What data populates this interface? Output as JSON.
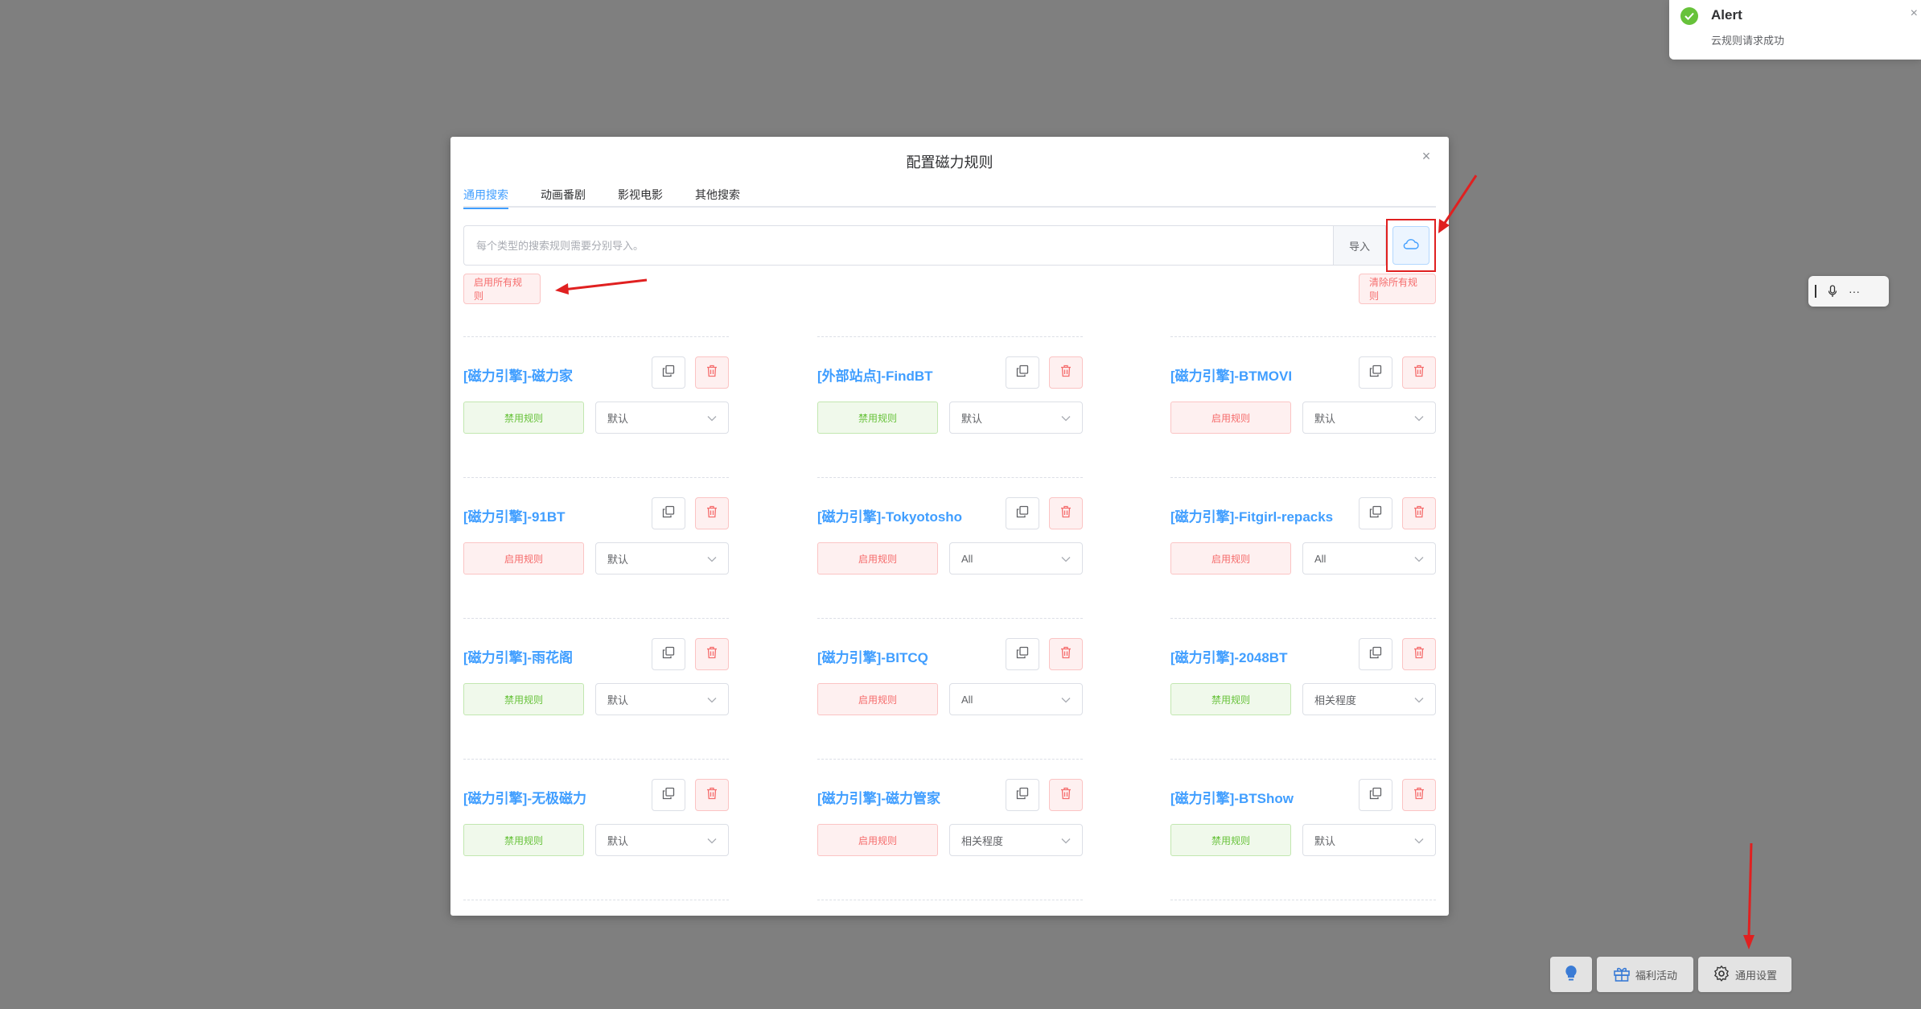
{
  "modal": {
    "title": "配置磁力规则",
    "close_icon": "×"
  },
  "tabs": [
    {
      "label": "通用搜索",
      "active": true
    },
    {
      "label": "动画番剧",
      "active": false
    },
    {
      "label": "影视电影",
      "active": false
    },
    {
      "label": "其他搜索",
      "active": false
    }
  ],
  "import": {
    "placeholder": "每个类型的搜索规则需要分别导入。",
    "button_label": "导入",
    "cloud_icon": "cloud-icon"
  },
  "actions": {
    "enable_all": "启用所有规则",
    "clear_all": "清除所有规则"
  },
  "rules": [
    {
      "name": "[磁力引擎]-磁力家",
      "toggle": "禁用规则",
      "state": "disable",
      "sort": "默认"
    },
    {
      "name": "[外部站点]-FindBT",
      "toggle": "禁用规则",
      "state": "disable",
      "sort": "默认"
    },
    {
      "name": "[磁力引擎]-BTMOVI",
      "toggle": "启用规则",
      "state": "enable",
      "sort": "默认"
    },
    {
      "name": "[磁力引擎]-91BT",
      "toggle": "启用规则",
      "state": "enable",
      "sort": "默认"
    },
    {
      "name": "[磁力引擎]-Tokyotosho",
      "toggle": "启用规则",
      "state": "enable",
      "sort": "All"
    },
    {
      "name": "[磁力引擎]-Fitgirl-repacks",
      "toggle": "启用规则",
      "state": "enable",
      "sort": "All"
    },
    {
      "name": "[磁力引擎]-雨花阁",
      "toggle": "禁用规则",
      "state": "disable",
      "sort": "默认"
    },
    {
      "name": "[磁力引擎]-BITCQ",
      "toggle": "启用规则",
      "state": "enable",
      "sort": "All"
    },
    {
      "name": "[磁力引擎]-2048BT",
      "toggle": "禁用规则",
      "state": "disable",
      "sort": "相关程度"
    },
    {
      "name": "[磁力引擎]-无极磁力",
      "toggle": "禁用规则",
      "state": "disable",
      "sort": "默认"
    },
    {
      "name": "[磁力引擎]-磁力管家",
      "toggle": "启用规则",
      "state": "enable",
      "sort": "相关程度"
    },
    {
      "name": "[磁力引擎]-BTShow",
      "toggle": "禁用规则",
      "state": "disable",
      "sort": "默认"
    }
  ],
  "alert": {
    "title": "Alert",
    "message": "云规则请求成功",
    "close_icon": "×"
  },
  "float_toolbar": {
    "more_label": "···"
  },
  "bottom_bar": {
    "welfare_label": "福利活动",
    "settings_label": "通用设置"
  },
  "colors": {
    "primary": "#409eff",
    "danger": "#f56c6c",
    "success": "#67c23a",
    "overlay": "#7f7f7f",
    "annotation_red": "#e02020"
  }
}
